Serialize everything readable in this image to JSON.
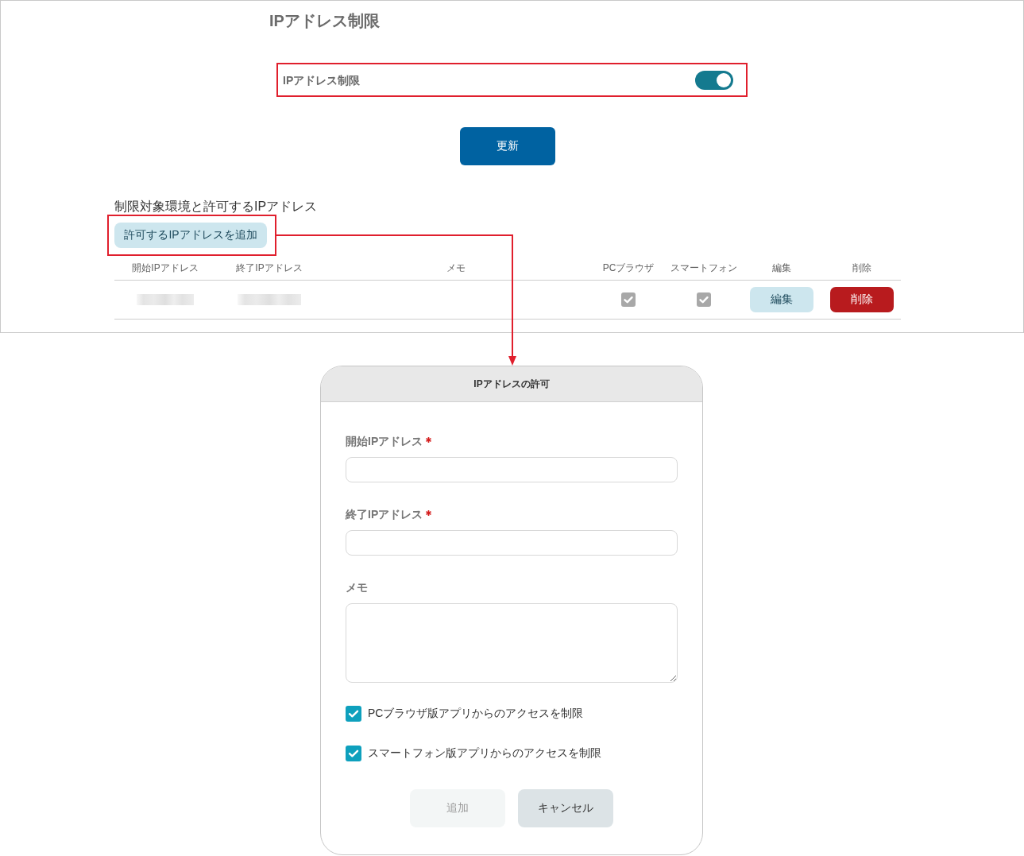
{
  "settings": {
    "title": "IPアドレス制限",
    "restriction_toggle": {
      "label": "IPアドレス制限",
      "on": true,
      "highlighted": true
    },
    "update_button": "更新",
    "section_title": "制限対象環境と許可するIPアドレス",
    "add_button": {
      "label": "許可するIPアドレスを追加",
      "highlighted": true
    },
    "table": {
      "columns": [
        "開始IPアドレス",
        "終了IPアドレス",
        "メモ",
        "PCブラウザ",
        "スマートフォン",
        "編集",
        "削除"
      ],
      "rows": [
        {
          "pc_browser": true,
          "smartphone": true,
          "edit_button": "編集",
          "delete_button": "削除"
        }
      ]
    }
  },
  "dialog": {
    "title": "IPアドレスの許可",
    "fields": [
      {
        "kind": "input",
        "label": "開始IPアドレス",
        "required": true
      },
      {
        "kind": "input",
        "label": "終了IPアドレス",
        "required": true
      },
      {
        "kind": "textarea",
        "label": "メモ",
        "required": false
      }
    ],
    "checkboxes": [
      {
        "label": "PCブラウザ版アプリからのアクセスを制限",
        "checked": true
      },
      {
        "label": "スマートフォン版アプリからのアクセスを制限",
        "checked": true
      }
    ],
    "buttons": [
      {
        "label": "追加",
        "disabled": true
      },
      {
        "label": "キャンセル",
        "disabled": false
      }
    ]
  }
}
